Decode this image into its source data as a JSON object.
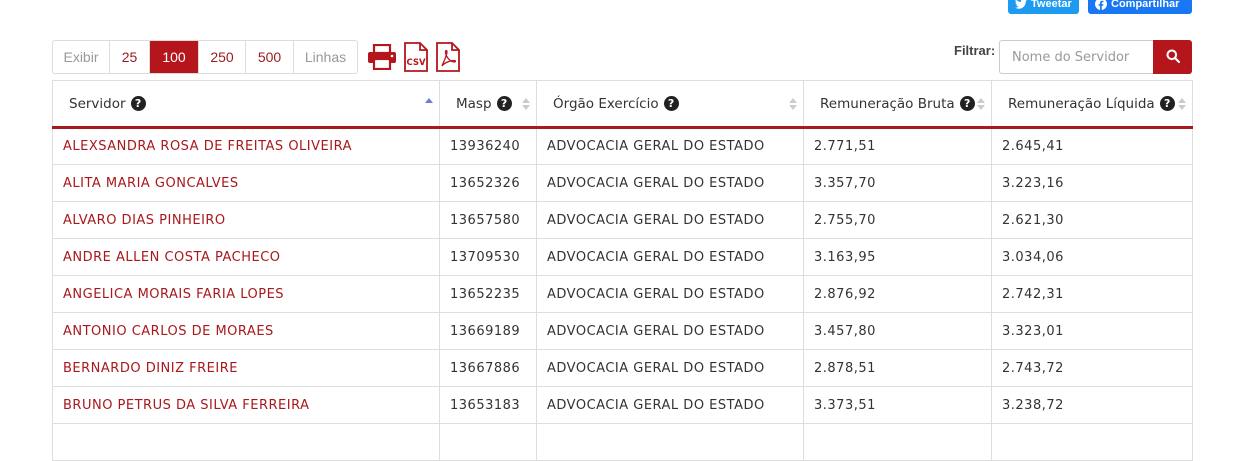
{
  "social": {
    "tweet_label": "Tweetar",
    "share_label": "Compartilhar"
  },
  "pager": {
    "show_label": "Exibir",
    "options": [
      "25",
      "100",
      "250",
      "500"
    ],
    "selected": "100",
    "lines_label": "Linhas"
  },
  "export": {
    "print_icon": "printer-icon",
    "csv_icon": "csv-file-icon",
    "csv_text": "CSV",
    "pdf_icon": "pdf-file-icon"
  },
  "filter": {
    "label": "Filtrar:",
    "placeholder": "Nome do Servidor",
    "button_icon": "search-icon"
  },
  "colors": {
    "accent": "#b5161c",
    "link": "#a8181c",
    "tweet": "#1d9bf0",
    "share": "#1877f2"
  },
  "table": {
    "headers": [
      {
        "label": "Servidor",
        "sort": "asc"
      },
      {
        "label": "Masp",
        "sort": "none"
      },
      {
        "label": "Órgão Exercício",
        "sort": "none"
      },
      {
        "label": "Remuneração Bruta",
        "sort": "none"
      },
      {
        "label": "Remuneração Líquida",
        "sort": "none"
      }
    ],
    "rows": [
      [
        "ALEXSANDRA ROSA DE FREITAS OLIVEIRA",
        "13936240",
        "ADVOCACIA GERAL DO ESTADO",
        "2.771,51",
        "2.645,41"
      ],
      [
        "ALITA MARIA GONCALVES",
        "13652326",
        "ADVOCACIA GERAL DO ESTADO",
        "3.357,70",
        "3.223,16"
      ],
      [
        "ALVARO DIAS PINHEIRO",
        "13657580",
        "ADVOCACIA GERAL DO ESTADO",
        "2.755,70",
        "2.621,30"
      ],
      [
        "ANDRE ALLEN COSTA PACHECO",
        "13709530",
        "ADVOCACIA GERAL DO ESTADO",
        "3.163,95",
        "3.034,06"
      ],
      [
        "ANGELICA MORAIS FARIA LOPES",
        "13652235",
        "ADVOCACIA GERAL DO ESTADO",
        "2.876,92",
        "2.742,31"
      ],
      [
        "ANTONIO CARLOS DE MORAES",
        "13669189",
        "ADVOCACIA GERAL DO ESTADO",
        "3.457,80",
        "3.323,01"
      ],
      [
        "BERNARDO DINIZ FREIRE",
        "13667886",
        "ADVOCACIA GERAL DO ESTADO",
        "2.878,51",
        "2.743,72"
      ],
      [
        "BRUNO PETRUS DA SILVA FERREIRA",
        "13653183",
        "ADVOCACIA GERAL DO ESTADO",
        "3.373,51",
        "3.238,72"
      ],
      [
        "",
        "",
        "",
        "",
        ""
      ]
    ]
  }
}
